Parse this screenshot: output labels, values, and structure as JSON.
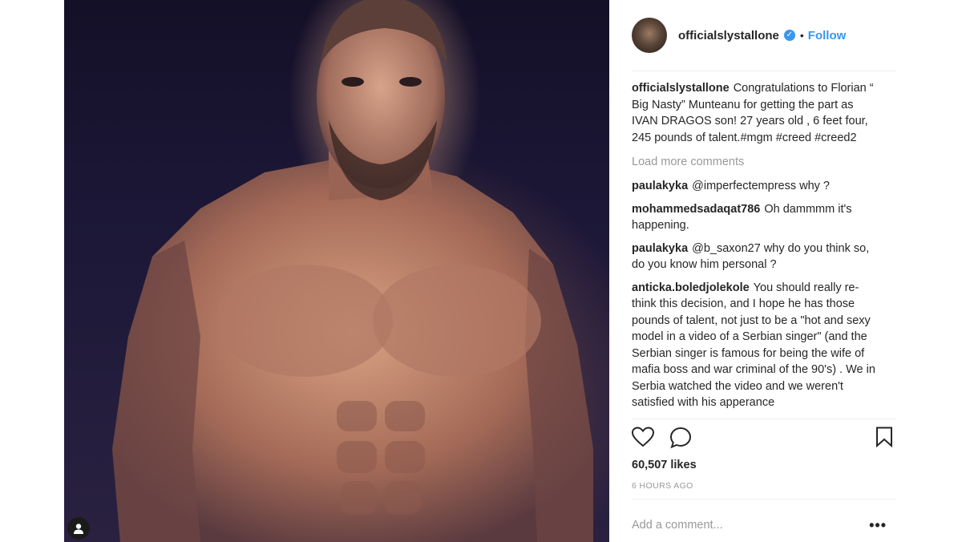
{
  "post": {
    "username": "officialslystallone",
    "follow_label": "Follow",
    "separator": "•",
    "verified_mark": "✓",
    "caption": "Congratulations to Florian “ Big Nasty” Munteanu for getting the part as IVAN DRAGOS son! 27 years old , 6 feet four, 245 pounds of talent.#mgm #creed #creed2",
    "load_more_label": "Load more comments",
    "comments": [
      {
        "user": "paulakyka",
        "text": "@imperfectempress why ?"
      },
      {
        "user": "mohammedsadaqat786",
        "text": "Oh dammmm it's happening."
      },
      {
        "user": "paulakyka",
        "text": "@b_saxon27 why do you think so, do you know him personal ?"
      },
      {
        "user": "anticka.boledjolekole",
        "text": "You should really re-think this decision, and I hope he has those pounds of talent, not just to be a \"hot and sexy model in a video of a Serbian singer\" (and the Serbian singer is famous for being the wife of mafia boss and war criminal of the 90's) . We in Serbia watched the video and we weren't satisfied with his apperance"
      }
    ],
    "likes": "60,507 likes",
    "timestamp": "6 HOURS AGO",
    "add_comment_placeholder": "Add a comment...",
    "more_options_label": "•••"
  },
  "icons": {
    "like": "heart-icon",
    "comment": "speech-bubble-icon",
    "save": "bookmark-icon",
    "tagged": "person-icon",
    "verified": "verified-badge-icon",
    "more": "ellipsis-icon"
  },
  "colors": {
    "link_blue": "#3897f0",
    "muted_gray": "#999999",
    "text": "#262626"
  }
}
